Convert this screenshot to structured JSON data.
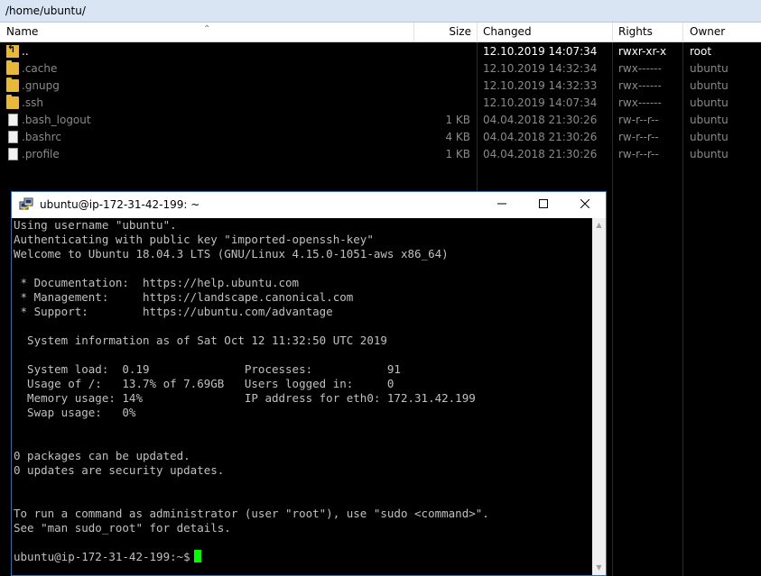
{
  "path": "/home/ubuntu/",
  "columns": {
    "name": "Name",
    "size": "Size",
    "changed": "Changed",
    "rights": "Rights",
    "owner": "Owner"
  },
  "files": [
    {
      "name": "..",
      "size": "",
      "changed": "12.10.2019 14:07:34",
      "rights": "rwxr-xr-x",
      "owner": "root",
      "type": "updir"
    },
    {
      "name": ".cache",
      "size": "",
      "changed": "12.10.2019 14:32:34",
      "rights": "rwx------",
      "owner": "ubuntu",
      "type": "folder"
    },
    {
      "name": ".gnupg",
      "size": "",
      "changed": "12.10.2019 14:32:33",
      "rights": "rwx------",
      "owner": "ubuntu",
      "type": "folder"
    },
    {
      "name": ".ssh",
      "size": "",
      "changed": "12.10.2019 14:07:34",
      "rights": "rwx------",
      "owner": "ubuntu",
      "type": "folder"
    },
    {
      "name": ".bash_logout",
      "size": "1 KB",
      "changed": "04.04.2018 21:30:26",
      "rights": "rw-r--r--",
      "owner": "ubuntu",
      "type": "file"
    },
    {
      "name": ".bashrc",
      "size": "4 KB",
      "changed": "04.04.2018 21:30:26",
      "rights": "rw-r--r--",
      "owner": "ubuntu",
      "type": "file"
    },
    {
      "name": ".profile",
      "size": "1 KB",
      "changed": "04.04.2018 21:30:26",
      "rights": "rw-r--r--",
      "owner": "ubuntu",
      "type": "file"
    }
  ],
  "terminal": {
    "title": "ubuntu@ip-172-31-42-199: ~",
    "lines": [
      "Using username \"ubuntu\".",
      "Authenticating with public key \"imported-openssh-key\"",
      "Welcome to Ubuntu 18.04.3 LTS (GNU/Linux 4.15.0-1051-aws x86_64)",
      "",
      " * Documentation:  https://help.ubuntu.com",
      " * Management:     https://landscape.canonical.com",
      " * Support:        https://ubuntu.com/advantage",
      "",
      "  System information as of Sat Oct 12 11:32:50 UTC 2019",
      "",
      "  System load:  0.19              Processes:           91",
      "  Usage of /:   13.7% of 7.69GB   Users logged in:     0",
      "  Memory usage: 14%               IP address for eth0: 172.31.42.199",
      "  Swap usage:   0%",
      "",
      "",
      "0 packages can be updated.",
      "0 updates are security updates.",
      "",
      "",
      "To run a command as administrator (user \"root\"), use \"sudo <command>\".",
      "See \"man sudo_root\" for details.",
      ""
    ],
    "prompt": "ubuntu@ip-172-31-42-199:~$"
  },
  "colors": {
    "cursor": "#00ff00",
    "pathbar": "#d9e5f3",
    "folder": "#e8b83b"
  }
}
